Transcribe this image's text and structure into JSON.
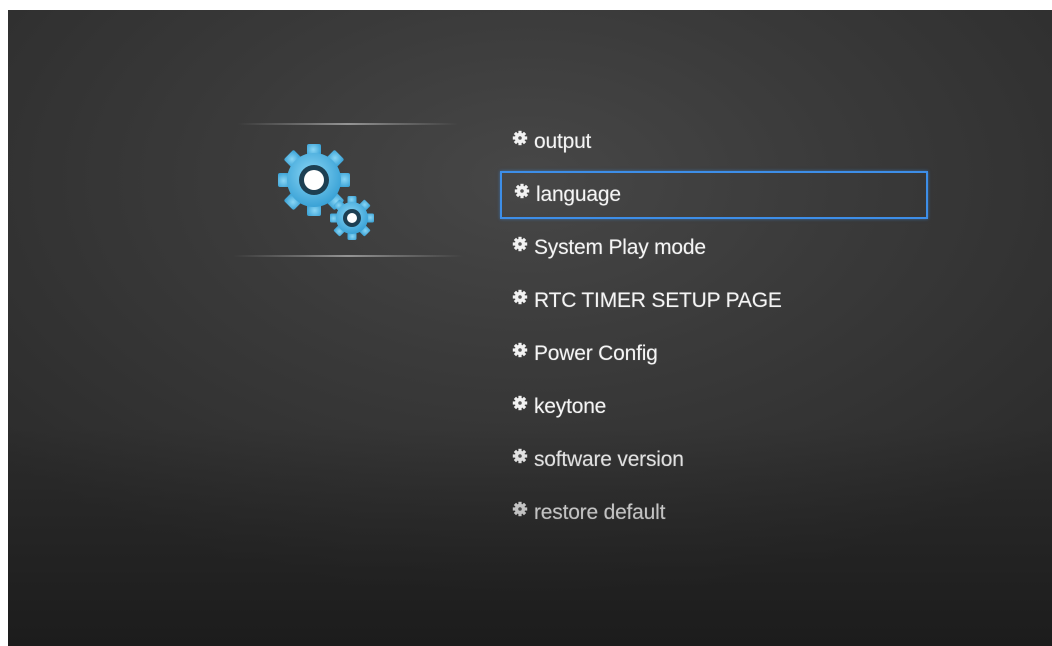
{
  "menu": {
    "items": [
      {
        "label": "output",
        "selected": false
      },
      {
        "label": "language",
        "selected": true
      },
      {
        "label": "System Play mode",
        "selected": false
      },
      {
        "label": "RTC TIMER SETUP PAGE",
        "selected": false
      },
      {
        "label": "Power Config",
        "selected": false
      },
      {
        "label": "keytone",
        "selected": false
      },
      {
        "label": "software version",
        "selected": false
      },
      {
        "label": "restore default",
        "selected": false
      }
    ],
    "bullet_icon": "gear-bullet-icon"
  },
  "header_icon": "settings-gears-icon",
  "colors": {
    "background": "#3a3a3a",
    "gear": "#56b8e6",
    "selection_border": "#3d8ee8",
    "text": "#f4f4f4"
  }
}
